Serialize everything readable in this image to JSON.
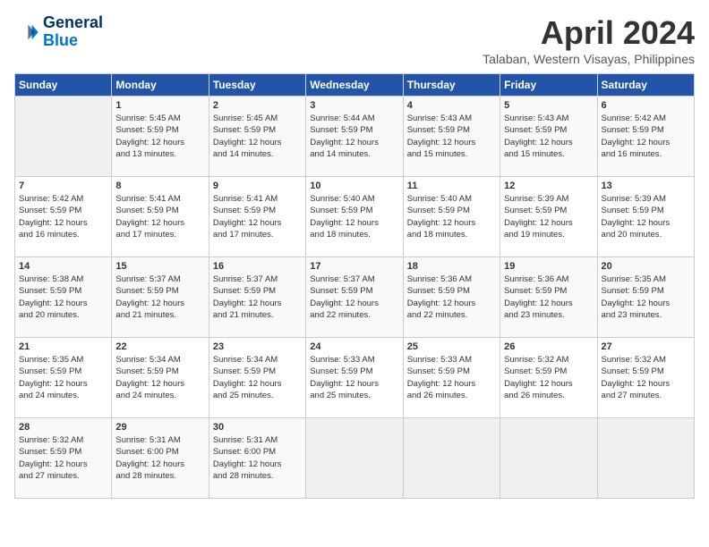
{
  "header": {
    "logo_line1": "General",
    "logo_line2": "Blue",
    "month": "April 2024",
    "location": "Talaban, Western Visayas, Philippines"
  },
  "weekdays": [
    "Sunday",
    "Monday",
    "Tuesday",
    "Wednesday",
    "Thursday",
    "Friday",
    "Saturday"
  ],
  "weeks": [
    [
      {
        "day": "",
        "info": ""
      },
      {
        "day": "1",
        "info": "Sunrise: 5:45 AM\nSunset: 5:59 PM\nDaylight: 12 hours\nand 13 minutes."
      },
      {
        "day": "2",
        "info": "Sunrise: 5:45 AM\nSunset: 5:59 PM\nDaylight: 12 hours\nand 14 minutes."
      },
      {
        "day": "3",
        "info": "Sunrise: 5:44 AM\nSunset: 5:59 PM\nDaylight: 12 hours\nand 14 minutes."
      },
      {
        "day": "4",
        "info": "Sunrise: 5:43 AM\nSunset: 5:59 PM\nDaylight: 12 hours\nand 15 minutes."
      },
      {
        "day": "5",
        "info": "Sunrise: 5:43 AM\nSunset: 5:59 PM\nDaylight: 12 hours\nand 15 minutes."
      },
      {
        "day": "6",
        "info": "Sunrise: 5:42 AM\nSunset: 5:59 PM\nDaylight: 12 hours\nand 16 minutes."
      }
    ],
    [
      {
        "day": "7",
        "info": "Sunrise: 5:42 AM\nSunset: 5:59 PM\nDaylight: 12 hours\nand 16 minutes."
      },
      {
        "day": "8",
        "info": "Sunrise: 5:41 AM\nSunset: 5:59 PM\nDaylight: 12 hours\nand 17 minutes."
      },
      {
        "day": "9",
        "info": "Sunrise: 5:41 AM\nSunset: 5:59 PM\nDaylight: 12 hours\nand 17 minutes."
      },
      {
        "day": "10",
        "info": "Sunrise: 5:40 AM\nSunset: 5:59 PM\nDaylight: 12 hours\nand 18 minutes."
      },
      {
        "day": "11",
        "info": "Sunrise: 5:40 AM\nSunset: 5:59 PM\nDaylight: 12 hours\nand 18 minutes."
      },
      {
        "day": "12",
        "info": "Sunrise: 5:39 AM\nSunset: 5:59 PM\nDaylight: 12 hours\nand 19 minutes."
      },
      {
        "day": "13",
        "info": "Sunrise: 5:39 AM\nSunset: 5:59 PM\nDaylight: 12 hours\nand 20 minutes."
      }
    ],
    [
      {
        "day": "14",
        "info": "Sunrise: 5:38 AM\nSunset: 5:59 PM\nDaylight: 12 hours\nand 20 minutes."
      },
      {
        "day": "15",
        "info": "Sunrise: 5:37 AM\nSunset: 5:59 PM\nDaylight: 12 hours\nand 21 minutes."
      },
      {
        "day": "16",
        "info": "Sunrise: 5:37 AM\nSunset: 5:59 PM\nDaylight: 12 hours\nand 21 minutes."
      },
      {
        "day": "17",
        "info": "Sunrise: 5:37 AM\nSunset: 5:59 PM\nDaylight: 12 hours\nand 22 minutes."
      },
      {
        "day": "18",
        "info": "Sunrise: 5:36 AM\nSunset: 5:59 PM\nDaylight: 12 hours\nand 22 minutes."
      },
      {
        "day": "19",
        "info": "Sunrise: 5:36 AM\nSunset: 5:59 PM\nDaylight: 12 hours\nand 23 minutes."
      },
      {
        "day": "20",
        "info": "Sunrise: 5:35 AM\nSunset: 5:59 PM\nDaylight: 12 hours\nand 23 minutes."
      }
    ],
    [
      {
        "day": "21",
        "info": "Sunrise: 5:35 AM\nSunset: 5:59 PM\nDaylight: 12 hours\nand 24 minutes."
      },
      {
        "day": "22",
        "info": "Sunrise: 5:34 AM\nSunset: 5:59 PM\nDaylight: 12 hours\nand 24 minutes."
      },
      {
        "day": "23",
        "info": "Sunrise: 5:34 AM\nSunset: 5:59 PM\nDaylight: 12 hours\nand 25 minutes."
      },
      {
        "day": "24",
        "info": "Sunrise: 5:33 AM\nSunset: 5:59 PM\nDaylight: 12 hours\nand 25 minutes."
      },
      {
        "day": "25",
        "info": "Sunrise: 5:33 AM\nSunset: 5:59 PM\nDaylight: 12 hours\nand 26 minutes."
      },
      {
        "day": "26",
        "info": "Sunrise: 5:32 AM\nSunset: 5:59 PM\nDaylight: 12 hours\nand 26 minutes."
      },
      {
        "day": "27",
        "info": "Sunrise: 5:32 AM\nSunset: 5:59 PM\nDaylight: 12 hours\nand 27 minutes."
      }
    ],
    [
      {
        "day": "28",
        "info": "Sunrise: 5:32 AM\nSunset: 5:59 PM\nDaylight: 12 hours\nand 27 minutes."
      },
      {
        "day": "29",
        "info": "Sunrise: 5:31 AM\nSunset: 6:00 PM\nDaylight: 12 hours\nand 28 minutes."
      },
      {
        "day": "30",
        "info": "Sunrise: 5:31 AM\nSunset: 6:00 PM\nDaylight: 12 hours\nand 28 minutes."
      },
      {
        "day": "",
        "info": ""
      },
      {
        "day": "",
        "info": ""
      },
      {
        "day": "",
        "info": ""
      },
      {
        "day": "",
        "info": ""
      }
    ]
  ]
}
